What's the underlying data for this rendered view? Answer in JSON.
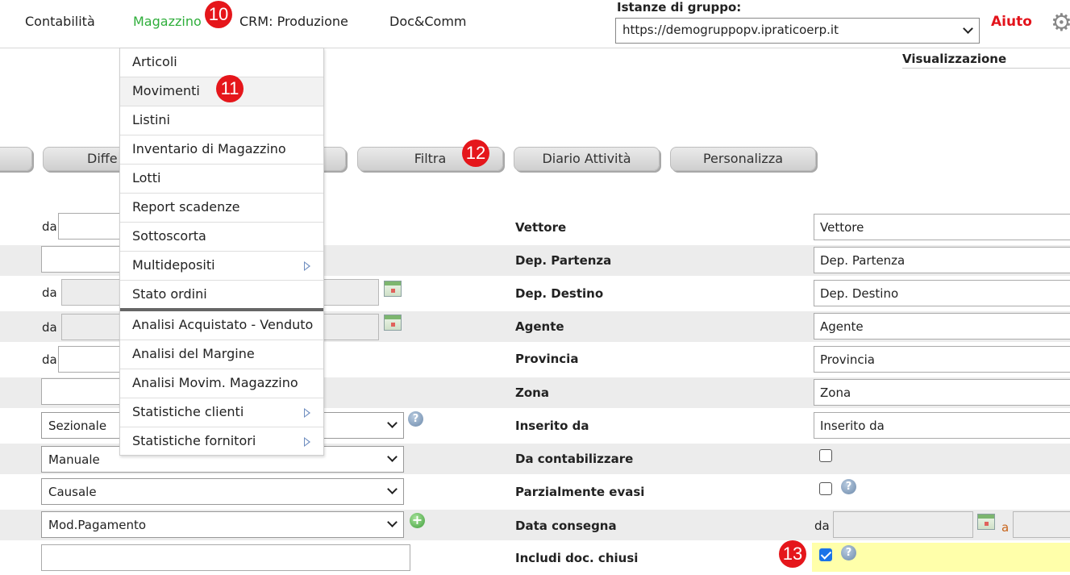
{
  "nav": {
    "items": [
      "Contabilità",
      "Magazzino",
      "CRM: Produzione",
      "Doc&Comm"
    ],
    "active": "Magazzino"
  },
  "instances": {
    "label": "Istanze di gruppo:",
    "selected": "https://demogruppopv.ipraticoerp.it"
  },
  "help_label": "Aiuto",
  "view_label": "Visualizzazione",
  "buttons": {
    "partial_left": "Diffe",
    "filter": "Filtra",
    "activity_log": "Diario Attività",
    "customize": "Personalizza"
  },
  "menu": {
    "items": [
      {
        "label": "Articoli"
      },
      {
        "label": "Movimenti"
      },
      {
        "label": "Listini"
      },
      {
        "label": "Inventario di Magazzino"
      },
      {
        "label": "Lotti"
      },
      {
        "label": "Report scadenze"
      },
      {
        "label": "Sottoscorta"
      },
      {
        "label": "Multidepositi",
        "submenu": true
      },
      {
        "label": "Stato ordini"
      },
      {
        "label": "Analisi Acquistato - Venduto"
      },
      {
        "label": "Analisi del Margine"
      },
      {
        "label": "Analisi Movim. Magazzino"
      },
      {
        "label": "Statistiche clienti",
        "submenu": true
      },
      {
        "label": "Statistiche fornitori",
        "submenu": true
      }
    ]
  },
  "left_form": {
    "from_label": "da",
    "selects": {
      "sezionale": "Sezionale",
      "manuale": "Manuale",
      "causale": "Causale",
      "pagamento": "Mod.Pagamento"
    }
  },
  "right_form": {
    "fields": [
      {
        "label": "Vettore",
        "value": "Vettore"
      },
      {
        "label": "Dep. Partenza",
        "value": "Dep. Partenza"
      },
      {
        "label": "Dep. Destino",
        "value": "Dep. Destino"
      },
      {
        "label": "Agente",
        "value": "Agente"
      },
      {
        "label": "Provincia",
        "value": "Provincia"
      },
      {
        "label": "Zona",
        "value": "Zona"
      },
      {
        "label": "Inserito da",
        "value": "Inserito da"
      }
    ],
    "to_be_accounted": {
      "label": "Da contabilizzare",
      "checked": false
    },
    "partially_fulfilled": {
      "label": "Parzialmente evasi",
      "checked": false
    },
    "delivery_date": {
      "label": "Data consegna",
      "from": "da",
      "to": "a"
    },
    "include_closed": {
      "label": "Includi doc. chiusi",
      "checked": true
    }
  },
  "markers": [
    "10",
    "11",
    "12",
    "13"
  ]
}
